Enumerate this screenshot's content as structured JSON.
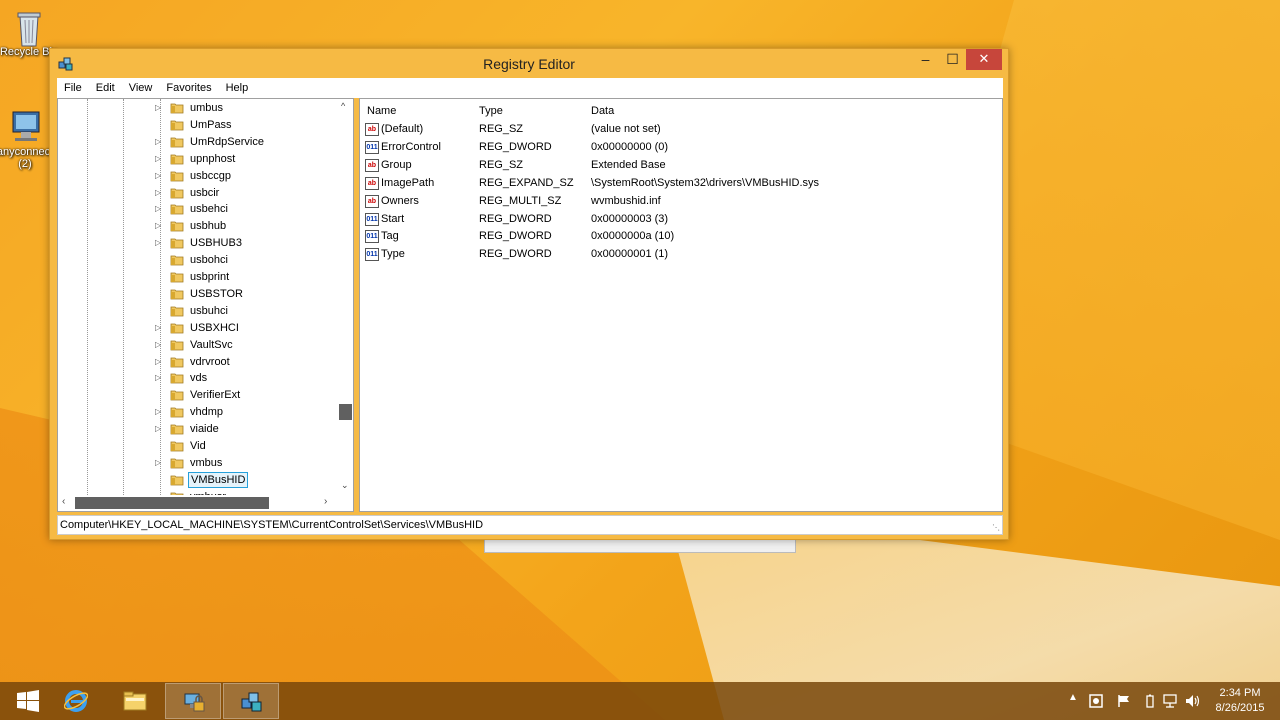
{
  "desktop": {
    "icons": [
      {
        "label": "Recycle Bin"
      },
      {
        "label": "anyconnect (2)"
      }
    ]
  },
  "window": {
    "title": "Registry Editor",
    "controls": {
      "minimize": "–",
      "maximize": "☐",
      "close": "✕"
    }
  },
  "menu": [
    "File",
    "Edit",
    "View",
    "Favorites",
    "Help"
  ],
  "tree": {
    "items": [
      {
        "label": "umbus",
        "expandable": true
      },
      {
        "label": "UmPass",
        "expandable": false
      },
      {
        "label": "UmRdpService",
        "expandable": true
      },
      {
        "label": "upnphost",
        "expandable": true
      },
      {
        "label": "usbccgp",
        "expandable": true
      },
      {
        "label": "usbcir",
        "expandable": true
      },
      {
        "label": "usbehci",
        "expandable": true
      },
      {
        "label": "usbhub",
        "expandable": true
      },
      {
        "label": "USBHUB3",
        "expandable": true
      },
      {
        "label": "usbohci",
        "expandable": false
      },
      {
        "label": "usbprint",
        "expandable": false
      },
      {
        "label": "USBSTOR",
        "expandable": false
      },
      {
        "label": "usbuhci",
        "expandable": false
      },
      {
        "label": "USBXHCI",
        "expandable": true
      },
      {
        "label": "VaultSvc",
        "expandable": true
      },
      {
        "label": "vdrvroot",
        "expandable": true
      },
      {
        "label": "vds",
        "expandable": true
      },
      {
        "label": "VerifierExt",
        "expandable": false
      },
      {
        "label": "vhdmp",
        "expandable": true
      },
      {
        "label": "viaide",
        "expandable": true
      },
      {
        "label": "Vid",
        "expandable": false
      },
      {
        "label": "vmbus",
        "expandable": true
      },
      {
        "label": "VMBusHID",
        "expandable": false,
        "selected": true
      },
      {
        "label": "vmbusr",
        "expandable": false
      }
    ]
  },
  "list": {
    "columns": {
      "name": "Name",
      "type": "Type",
      "data": "Data"
    },
    "rows": [
      {
        "name": "(Default)",
        "type": "REG_SZ",
        "data": "(value not set)",
        "icon": "ab"
      },
      {
        "name": "ErrorControl",
        "type": "REG_DWORD",
        "data": "0x00000000 (0)",
        "icon": "011"
      },
      {
        "name": "Group",
        "type": "REG_SZ",
        "data": "Extended Base",
        "icon": "ab"
      },
      {
        "name": "ImagePath",
        "type": "REG_EXPAND_SZ",
        "data": "\\SystemRoot\\System32\\drivers\\VMBusHID.sys",
        "icon": "ab"
      },
      {
        "name": "Owners",
        "type": "REG_MULTI_SZ",
        "data": "wvmbushid.inf",
        "icon": "ab"
      },
      {
        "name": "Start",
        "type": "REG_DWORD",
        "data": "0x00000003 (3)",
        "icon": "011"
      },
      {
        "name": "Tag",
        "type": "REG_DWORD",
        "data": "0x0000000a (10)",
        "icon": "011"
      },
      {
        "name": "Type",
        "type": "REG_DWORD",
        "data": "0x00000001 (1)",
        "icon": "011"
      }
    ]
  },
  "status": {
    "path": "Computer\\HKEY_LOCAL_MACHINE\\SYSTEM\\CurrentControlSet\\Services\\VMBusHID"
  },
  "taskbar": {
    "apps": [
      {
        "name": "start-icon"
      },
      {
        "name": "internet-explorer-icon"
      },
      {
        "name": "file-explorer-icon"
      },
      {
        "name": "network-lock-icon"
      },
      {
        "name": "registry-editor-icon"
      }
    ],
    "clock": {
      "time": "2:34 PM",
      "date": "8/26/2015"
    }
  },
  "colors": {
    "accent": "#26a0da",
    "close": "#c7463b",
    "taskbar": "#784610"
  }
}
